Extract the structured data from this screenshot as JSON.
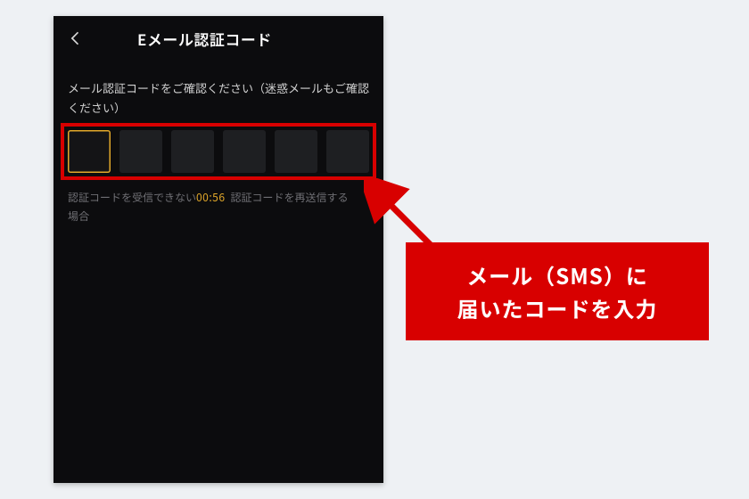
{
  "appBar": {
    "title": "Eメール認証コード"
  },
  "instruction": "メール認証コードをご確認ください（迷惑メールもご確認ください）",
  "codeInput": {
    "cellCount": 6,
    "activeIndex": 0
  },
  "helpRow": {
    "cannotReceive": "認証コードを受信できない場合",
    "timer": "00:56",
    "resend": "認証コードを再送信する"
  },
  "callout": {
    "line1": "メール（SMS）に",
    "line2": "届いたコードを入力"
  },
  "colors": {
    "accent": "#e2a82a",
    "annotation": "#d80000"
  }
}
